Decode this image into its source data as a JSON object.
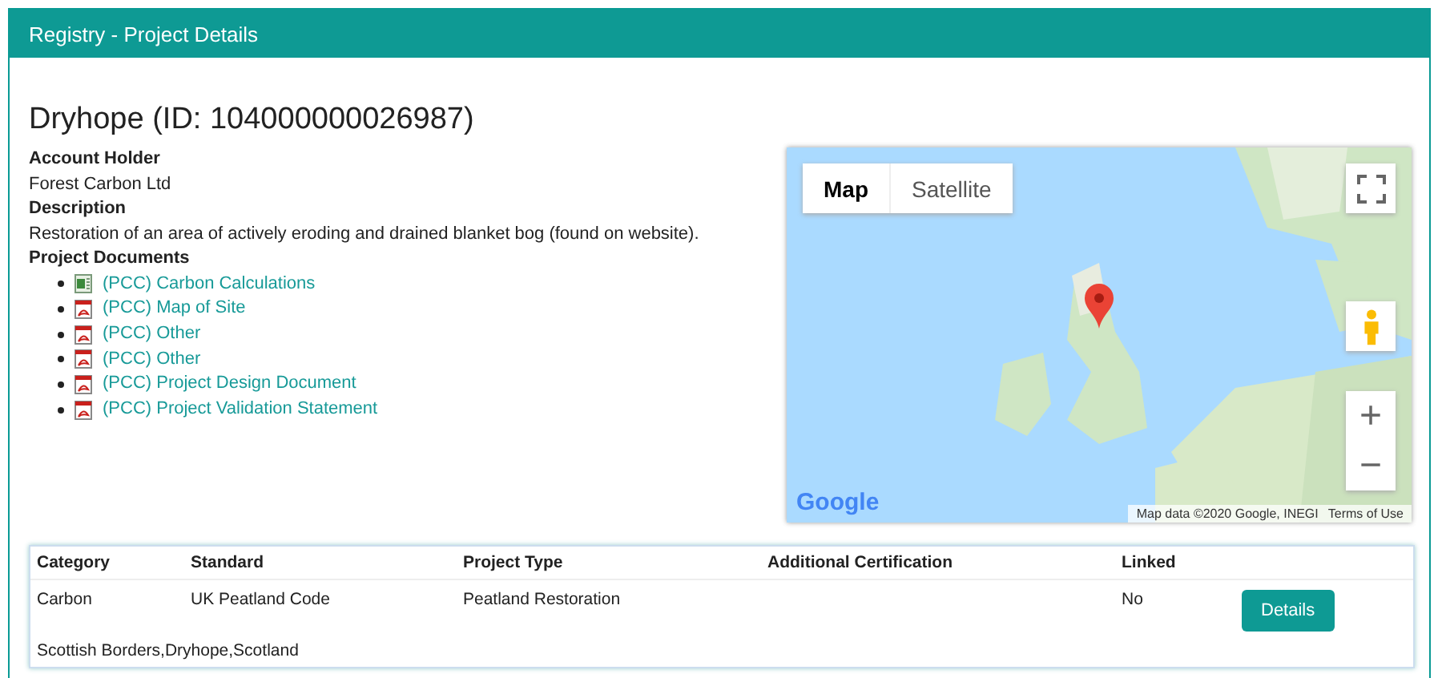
{
  "panel": {
    "title": "Registry - Project Details"
  },
  "project": {
    "heading": "Dryhope (ID: 104000000026987)",
    "fields": [
      {
        "label": "Account Holder",
        "value": "Forest Carbon Ltd"
      },
      {
        "label": "Description",
        "value": "Restoration of an area of actively eroding and drained blanket bog (found on website)."
      }
    ],
    "documents_label": "Project Documents",
    "documents": [
      {
        "kind": "spreadsheet",
        "label": "(PCC) Carbon Calculations"
      },
      {
        "kind": "pdf",
        "label": "(PCC) Map of Site"
      },
      {
        "kind": "pdf",
        "label": "(PCC) Other"
      },
      {
        "kind": "pdf",
        "label": "(PCC) Other"
      },
      {
        "kind": "pdf",
        "label": "(PCC) Project Design Document"
      },
      {
        "kind": "pdf",
        "label": "(PCC) Project Validation Statement"
      }
    ]
  },
  "map": {
    "kind": "picture",
    "map_types": [
      {
        "label": "Map",
        "selected": true
      },
      {
        "label": "Satellite",
        "selected": false
      }
    ],
    "zoom_in": "+",
    "zoom_out": "−",
    "logo": "Google",
    "attribution": "Map data ©2020 Google, INEGI",
    "terms": "Terms of Use"
  },
  "table": {
    "columns": [
      "Category",
      "Standard",
      "Project Type",
      "Additional Certification",
      "Linked"
    ],
    "rows": [
      {
        "cells": [
          "Carbon",
          "UK Peatland Code",
          "Peatland Restoration",
          "",
          "No"
        ],
        "button": "Details",
        "location": "Scottish Borders,Dryhope,Scotland"
      }
    ]
  }
}
